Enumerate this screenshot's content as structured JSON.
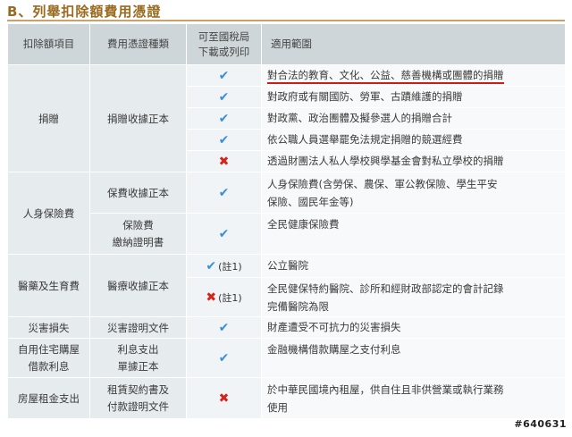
{
  "section_title": "B、列舉扣除額費用憑證",
  "headers": {
    "item": "扣除額項目",
    "voucher": "費用憑證種類",
    "download_line1": "可至國稅局",
    "download_line2": "下載或列印",
    "scope": "適用範圍"
  },
  "rows": {
    "donation": {
      "item": "捐贈",
      "voucher": "捐贈收據正本",
      "entries": [
        {
          "mark": "✔",
          "scope": "對合法的教育、文化、公益、慈善機構或團體的捐贈"
        },
        {
          "mark": "✔",
          "scope": "對政府或有關國防、勞軍、古蹟維護的捐贈"
        },
        {
          "mark": "✔",
          "scope": "對政黨、政治團體及擬參選人的捐贈合計"
        },
        {
          "mark": "✔",
          "scope": "依公職人員選舉罷免法規定捐贈的競選經費"
        },
        {
          "mark": "✖",
          "scope": "透過財團法人私人學校興學基金會對私立學校的捐贈"
        }
      ]
    },
    "insurance": {
      "item": "人身保險費",
      "entries": [
        {
          "voucher": "保費收據正本",
          "mark": "✔",
          "scope_line1": "人身保險費(含勞保、農保、軍公教保險、學生平安",
          "scope_line2": "保險、國民年金等)"
        },
        {
          "voucher_line1": "保險費",
          "voucher_line2": "繳納證明書",
          "mark": "✔",
          "scope": "全民健康保險費"
        }
      ]
    },
    "medical": {
      "item": "醫藥及生育費",
      "voucher": "醫療收據正本",
      "entries": [
        {
          "mark": "✔",
          "note": "(註1)",
          "scope": "公立醫院"
        },
        {
          "mark": "✖",
          "note": "(註1)",
          "scope_line1": "全民健保特約醫院、診所和經財政部認定的會計記錄",
          "scope_line2": "完備醫院為限"
        }
      ]
    },
    "disaster": {
      "item": "災害損失",
      "voucher": "災害證明文件",
      "mark": "✔",
      "scope": "財產遭受不可抗力的災害損失"
    },
    "mortgage": {
      "item_line1": "自用住宅購屋",
      "item_line2": "借款利息",
      "voucher_line1": "利息支出",
      "voucher_line2": "單據正本",
      "mark": "✔",
      "scope": "金融機構借款購屋之支付利息"
    },
    "rent": {
      "item": "房屋租金支出",
      "voucher_line1": "租賃契約書及",
      "voucher_line2": "付款證明文件",
      "mark": "✖",
      "scope_line1": "於中華民國境內租屋，供自住且非供營業或執行業務",
      "scope_line2": "使用"
    }
  },
  "watermark": "#640631",
  "colors": {
    "check": "#3a8fd3",
    "cross": "#d4231a",
    "title": "#9a6a1f",
    "underline": "#d01a16"
  }
}
